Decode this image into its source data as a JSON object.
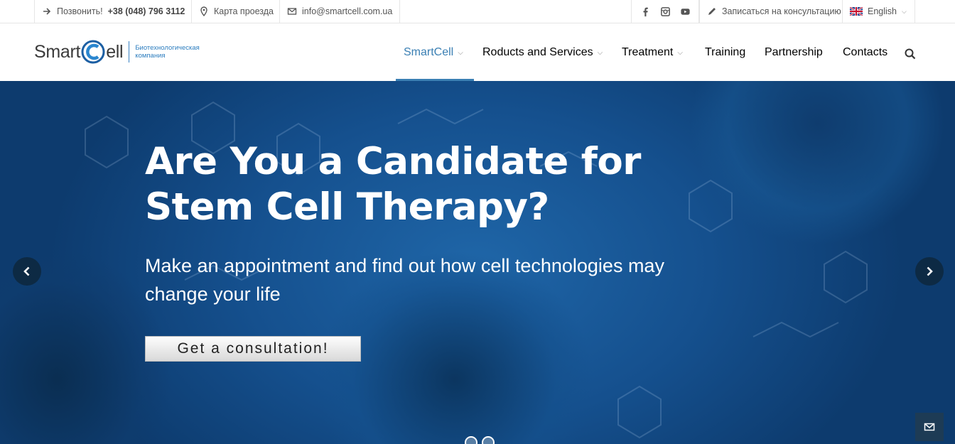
{
  "topbar": {
    "call_label": "Позвонить!",
    "phone": "+38 (048) 796 3112",
    "map_label": "Карта проезда",
    "email": "info@smartcell.com.ua",
    "social": [
      "facebook-icon",
      "instagram-icon",
      "youtube-icon"
    ],
    "consult_label": "Записаться на консультацию",
    "language": "English"
  },
  "header": {
    "logo_left": "Smart",
    "logo_right": "ell",
    "logo_sub_1": "Биотехнологическая",
    "logo_sub_2": "компания",
    "nav": [
      {
        "label": "SmartCell",
        "dropdown": true,
        "active": true
      },
      {
        "label": "Roducts and Services",
        "dropdown": true
      },
      {
        "label": "Treatment",
        "dropdown": true
      },
      {
        "label": "Training"
      },
      {
        "label": "Partnership"
      },
      {
        "label": "Contacts"
      }
    ]
  },
  "hero": {
    "headline_1": "Are You a Candidate for",
    "headline_2": "Stem Cell Therapy?",
    "sub_1": "Make an appointment and find out how cell technologies may",
    "sub_2": "change your life",
    "cta": "Get a consultation!",
    "slide_count": 2
  },
  "colors": {
    "accent": "#3a7fb3",
    "hero_bg": "#15508e"
  }
}
